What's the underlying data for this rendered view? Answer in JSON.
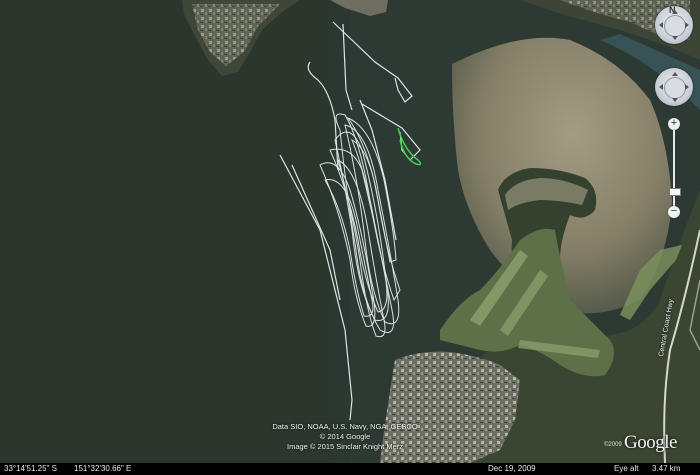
{
  "attribution": {
    "line1": "Data SIO, NOAA, U.S. Navy, NGA, GEBCO",
    "line2": "© 2014 Google",
    "line3": "Image © 2015 Sinclair Knight Merz"
  },
  "logo": {
    "text": "Google",
    "year": "©2009"
  },
  "road_label": "Central Coast Hwy",
  "status": {
    "latitude": "33°14'51.25\" S",
    "longitude": "151°32'30.66\" E",
    "date": "Dec 19, 2009",
    "eye_alt_label": "Eye alt",
    "eye_alt_value": "3.47 km"
  },
  "controls": {
    "north_label": "N",
    "zoom_in": "+",
    "zoom_out": "−"
  },
  "colors": {
    "water": "#2e3a2f",
    "track": "#e8f0f2",
    "track_highlight": "#3fd24a",
    "shoal": "#8f8a72",
    "land": "#2f3b27"
  }
}
